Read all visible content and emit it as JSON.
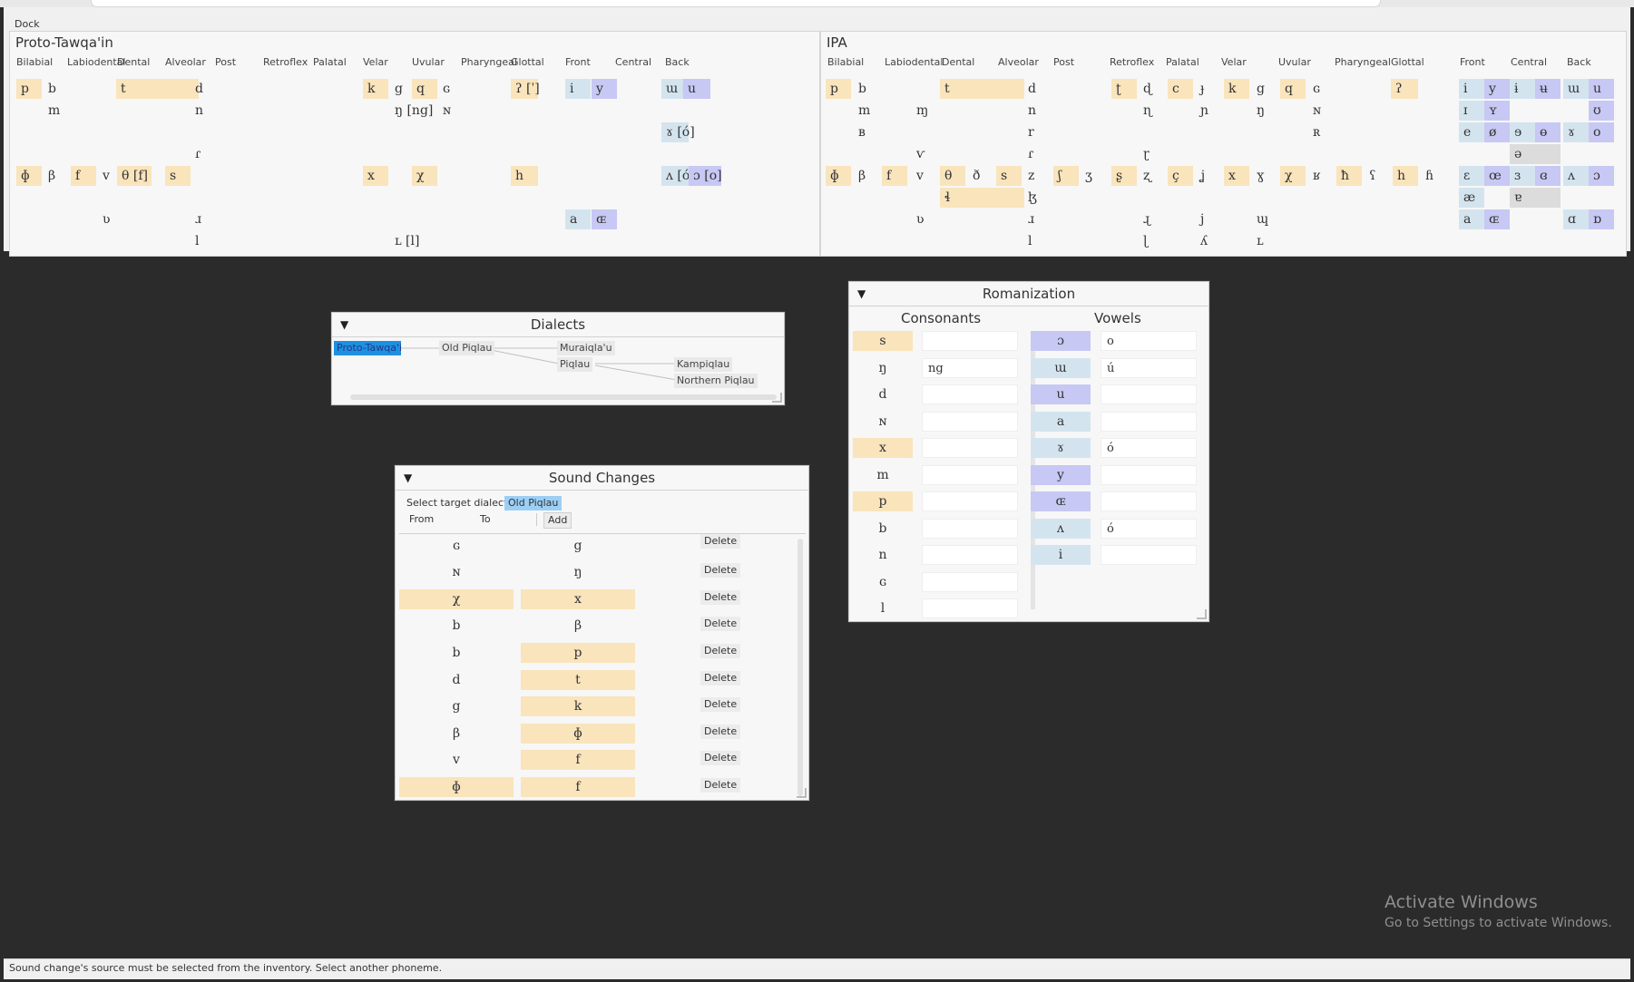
{
  "dock": {
    "title": "Dock"
  },
  "colors": {
    "red": "#f7c8cd",
    "yellow": "#f9e4bc",
    "blue": "#d4e4ef",
    "purple": "#c8c8f4",
    "gray": "#dcdcdc",
    "selection": "#1e90e0",
    "target_chip": "#9ccff6",
    "workspace": "#2b2b2b"
  },
  "proto": {
    "title": "Proto-Tawqa'in",
    "headers": [
      "Bilabial",
      "Labiodental",
      "Dental",
      "Alveolar",
      "Post",
      "Retroflex",
      "Palatal",
      "Velar",
      "Uvular",
      "Pharyngeal",
      "Glottal",
      "Front",
      "Central",
      "Back"
    ],
    "cells": [
      {
        "t": "p",
        "c": "y"
      },
      {
        "t": "b",
        "c": "r"
      },
      {
        "t": "t",
        "c": "y"
      },
      {
        "t": "d",
        "c": "r"
      },
      {
        "t": "k",
        "c": "y"
      },
      {
        "t": "g",
        "c": "r"
      },
      {
        "t": "q",
        "c": "y"
      },
      {
        "t": "ɢ",
        "c": "r"
      },
      {
        "t": "ʔ [ˈ]",
        "c": "y"
      },
      {
        "t": "i",
        "c": "b"
      },
      {
        "t": "y",
        "c": "p"
      },
      {
        "t": "ɯ [ú",
        "c": "b"
      },
      {
        "t": "u",
        "c": "p"
      },
      {
        "t": "m",
        "c": "r"
      },
      {
        "t": "n",
        "c": "r"
      },
      {
        "t": "ŋ [ng]",
        "c": "r"
      },
      {
        "t": "ɴ",
        "c": "r"
      },
      {
        "t": "ɤ [ó]",
        "c": "b"
      },
      {
        "t": "ɾ",
        "c": "r"
      },
      {
        "t": "ɸ",
        "c": "y"
      },
      {
        "t": "β",
        "c": "r"
      },
      {
        "t": "f",
        "c": "y"
      },
      {
        "t": "v",
        "c": "r"
      },
      {
        "t": "θ [f]",
        "c": "y"
      },
      {
        "t": "s",
        "c": "y"
      },
      {
        "t": "x",
        "c": "y"
      },
      {
        "t": "χ",
        "c": "y"
      },
      {
        "t": "h",
        "c": "y"
      },
      {
        "t": "ʌ [ó]",
        "c": "b"
      },
      {
        "t": "ɔ [o]",
        "c": "p"
      },
      {
        "t": "ʋ",
        "c": "r"
      },
      {
        "t": "ɹ",
        "c": "r"
      },
      {
        "t": "a",
        "c": "b"
      },
      {
        "t": "ɶ",
        "c": "p"
      },
      {
        "t": "l",
        "c": "r"
      },
      {
        "t": "ʟ [l]",
        "c": "r"
      }
    ]
  },
  "ipa": {
    "title": "IPA",
    "headers": [
      "Bilabial",
      "Labiodental",
      "Dental",
      "Alveolar",
      "Post",
      "Retroflex",
      "Palatal",
      "Velar",
      "Uvular",
      "Pharyngeal",
      "Glottal",
      "Front",
      "Central",
      "Back"
    ],
    "cells": [
      {
        "t": "p",
        "c": "y"
      },
      {
        "t": "b",
        "c": "r"
      },
      {
        "t": "t",
        "c": "y"
      },
      {
        "t": "d",
        "c": "r"
      },
      {
        "t": "ʈ",
        "c": "y"
      },
      {
        "t": "ɖ",
        "c": "r"
      },
      {
        "t": "c",
        "c": "y"
      },
      {
        "t": "ɟ",
        "c": "r"
      },
      {
        "t": "k",
        "c": "y"
      },
      {
        "t": "g",
        "c": "r"
      },
      {
        "t": "q",
        "c": "y"
      },
      {
        "t": "ɢ",
        "c": "r"
      },
      {
        "t": "ʔ",
        "c": "y"
      },
      {
        "t": "i",
        "c": "b"
      },
      {
        "t": "y",
        "c": "p"
      },
      {
        "t": "ɨ",
        "c": "b"
      },
      {
        "t": "ʉ",
        "c": "p"
      },
      {
        "t": "ɯ",
        "c": "b"
      },
      {
        "t": "u",
        "c": "p"
      },
      {
        "t": "m",
        "c": "r"
      },
      {
        "t": "ɱ",
        "c": "r"
      },
      {
        "t": "n",
        "c": "r"
      },
      {
        "t": "ɳ",
        "c": "r"
      },
      {
        "t": "ɲ",
        "c": "r"
      },
      {
        "t": "ŋ",
        "c": "r"
      },
      {
        "t": "ɴ",
        "c": "r"
      },
      {
        "t": "ɪ",
        "c": "b"
      },
      {
        "t": "ʏ",
        "c": "p"
      },
      {
        "t": "ʊ",
        "c": "p"
      },
      {
        "t": "ʙ",
        "c": "r"
      },
      {
        "t": "r",
        "c": "r"
      },
      {
        "t": "ʀ",
        "c": "r"
      },
      {
        "t": "e",
        "c": "b"
      },
      {
        "t": "ø",
        "c": "p"
      },
      {
        "t": "ɘ",
        "c": "b"
      },
      {
        "t": "ɵ",
        "c": "p"
      },
      {
        "t": "ɤ",
        "c": "b"
      },
      {
        "t": "o",
        "c": "p"
      },
      {
        "t": "ⱱ",
        "c": "r"
      },
      {
        "t": "ɾ",
        "c": "r"
      },
      {
        "t": "ɽ",
        "c": "r"
      },
      {
        "t": "ə",
        "c": "g"
      },
      {
        "t": "ɸ",
        "c": "y"
      },
      {
        "t": "β",
        "c": "r"
      },
      {
        "t": "f",
        "c": "y"
      },
      {
        "t": "v",
        "c": "r"
      },
      {
        "t": "θ",
        "c": "y"
      },
      {
        "t": "ð",
        "c": "r"
      },
      {
        "t": "s",
        "c": "y"
      },
      {
        "t": "z",
        "c": "r"
      },
      {
        "t": "ʃ",
        "c": "y"
      },
      {
        "t": "ʒ",
        "c": "r"
      },
      {
        "t": "ʂ",
        "c": "y"
      },
      {
        "t": "ʐ",
        "c": "r"
      },
      {
        "t": "ç",
        "c": "y"
      },
      {
        "t": "ʝ",
        "c": "r"
      },
      {
        "t": "x",
        "c": "y"
      },
      {
        "t": "ɣ",
        "c": "r"
      },
      {
        "t": "χ",
        "c": "y"
      },
      {
        "t": "ʁ",
        "c": "r"
      },
      {
        "t": "ħ",
        "c": "y"
      },
      {
        "t": "ʕ",
        "c": "r"
      },
      {
        "t": "h",
        "c": "y"
      },
      {
        "t": "ɦ",
        "c": "r"
      },
      {
        "t": "ɛ",
        "c": "b"
      },
      {
        "t": "œ",
        "c": "p"
      },
      {
        "t": "ɜ",
        "c": "b"
      },
      {
        "t": "ɞ",
        "c": "p"
      },
      {
        "t": "ʌ",
        "c": "b"
      },
      {
        "t": "ɔ",
        "c": "p"
      },
      {
        "t": "ɬ",
        "c": "y"
      },
      {
        "t": "ɮ",
        "c": "r"
      },
      {
        "t": "æ",
        "c": "b"
      },
      {
        "t": "ɐ",
        "c": "g"
      },
      {
        "t": "ʋ",
        "c": "r"
      },
      {
        "t": "ɹ",
        "c": "r"
      },
      {
        "t": "ɻ",
        "c": "r"
      },
      {
        "t": "j",
        "c": "r"
      },
      {
        "t": "ɰ",
        "c": "r"
      },
      {
        "t": "a",
        "c": "b"
      },
      {
        "t": "ɶ",
        "c": "p"
      },
      {
        "t": "ɑ",
        "c": "b"
      },
      {
        "t": "ɒ",
        "c": "p"
      },
      {
        "t": "l",
        "c": "r"
      },
      {
        "t": "ɭ",
        "c": "r"
      },
      {
        "t": "ʎ",
        "c": "r"
      },
      {
        "t": "ʟ",
        "c": "r"
      }
    ]
  },
  "dialects": {
    "title": "Dialects",
    "toggle": "▼",
    "nodes": [
      "Proto-Tawqa'in",
      "Old Piqlau",
      "Muraiqla'u",
      "Piqlau",
      "Kampiqlau",
      "Northern Piqlau"
    ]
  },
  "sound_changes": {
    "title": "Sound Changes",
    "toggle": "▼",
    "target_label": "Select target dialect",
    "target_value": "Old Piqlau",
    "from_label": "From",
    "to_label": "To",
    "add_label": "Add",
    "delete_label": "Delete",
    "rows": [
      {
        "from": "ɢ",
        "fc": "r",
        "to": "g",
        "tc": "r"
      },
      {
        "from": "ɴ",
        "fc": "r",
        "to": "ŋ",
        "tc": "r"
      },
      {
        "from": "χ",
        "fc": "y",
        "to": "x",
        "tc": "y"
      },
      {
        "from": "b",
        "fc": "r",
        "to": "β",
        "tc": "r"
      },
      {
        "from": "b",
        "fc": "r",
        "to": "p",
        "tc": "y"
      },
      {
        "from": "d",
        "fc": "r",
        "to": "t",
        "tc": "y"
      },
      {
        "from": "g",
        "fc": "r",
        "to": "k",
        "tc": "y"
      },
      {
        "from": "β",
        "fc": "r",
        "to": "ɸ",
        "tc": "y"
      },
      {
        "from": "v",
        "fc": "r",
        "to": "f",
        "tc": "y"
      },
      {
        "from": "ɸ",
        "fc": "y",
        "to": "f",
        "tc": "y"
      }
    ]
  },
  "romanization": {
    "title": "Romanization",
    "toggle": "▼",
    "consonants_label": "Consonants",
    "vowels_label": "Vowels",
    "consonants": [
      {
        "p": "s",
        "c": "y",
        "r": ""
      },
      {
        "p": "ŋ",
        "c": "r",
        "r": "ng"
      },
      {
        "p": "d",
        "c": "r",
        "r": ""
      },
      {
        "p": "ɴ",
        "c": "r",
        "r": ""
      },
      {
        "p": "x",
        "c": "y",
        "r": ""
      },
      {
        "p": "m",
        "c": "r",
        "r": ""
      },
      {
        "p": "p",
        "c": "y",
        "r": ""
      },
      {
        "p": "b",
        "c": "r",
        "r": ""
      },
      {
        "p": "n",
        "c": "r",
        "r": ""
      },
      {
        "p": "ɢ",
        "c": "r",
        "r": ""
      },
      {
        "p": "l",
        "c": "r",
        "r": ""
      }
    ],
    "vowels": [
      {
        "p": "ɔ",
        "c": "p",
        "r": "o"
      },
      {
        "p": "ɯ",
        "c": "b",
        "r": "ú"
      },
      {
        "p": "u",
        "c": "p",
        "r": ""
      },
      {
        "p": "a",
        "c": "b",
        "r": ""
      },
      {
        "p": "ɤ",
        "c": "b",
        "r": "ó"
      },
      {
        "p": "y",
        "c": "p",
        "r": ""
      },
      {
        "p": "ɶ",
        "c": "p",
        "r": ""
      },
      {
        "p": "ʌ",
        "c": "b",
        "r": "ó"
      },
      {
        "p": "i",
        "c": "b",
        "r": ""
      }
    ]
  },
  "watermark": {
    "title": "Activate Windows",
    "subtitle": "Go to Settings to activate Windows."
  },
  "status": {
    "text": "Sound change's source must be selected from the inventory. Select another phoneme."
  }
}
